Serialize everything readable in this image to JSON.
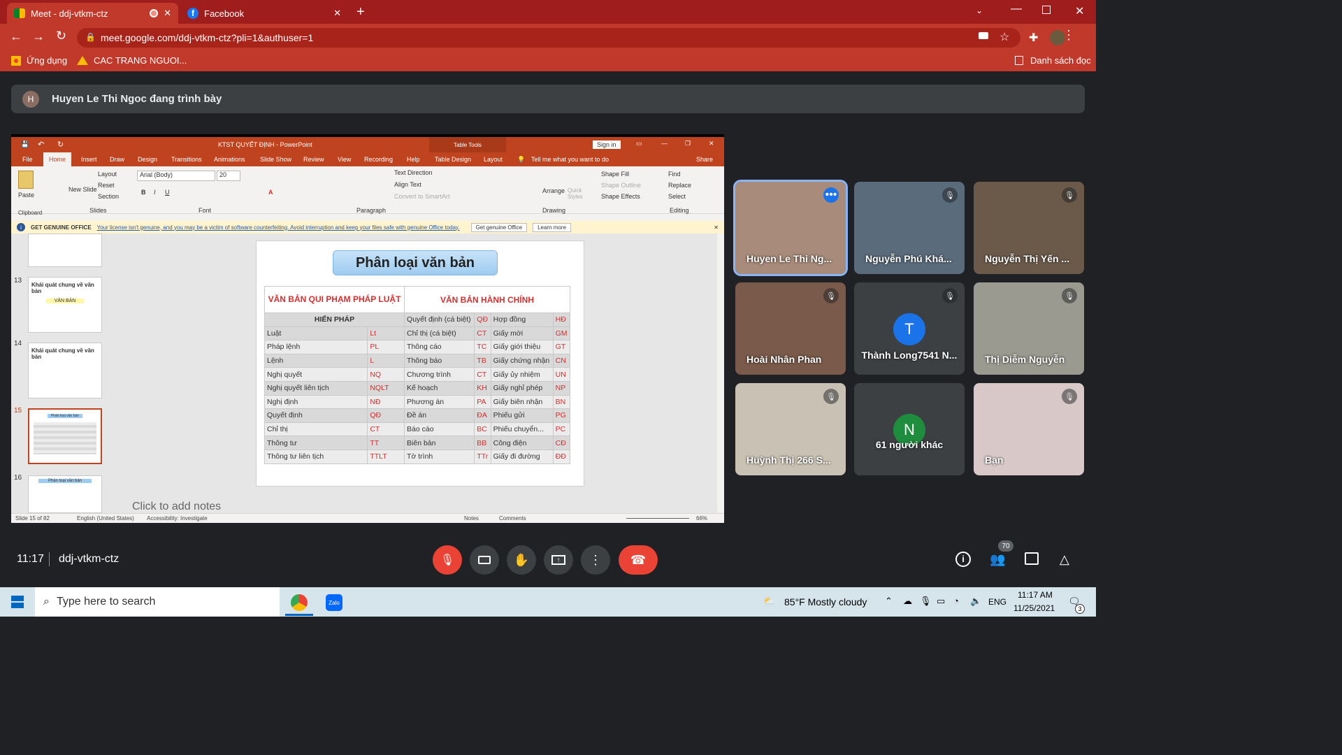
{
  "browser": {
    "tabs": [
      {
        "label": "Meet - ddj-vtkm-ctz",
        "active": true
      },
      {
        "label": "Facebook",
        "active": false
      }
    ],
    "url": "meet.google.com/ddj-vtkm-ctz?pli=1&authuser=1",
    "bookmarks": [
      "Ứng dụng",
      "CAC TRANG NGUOI..."
    ],
    "reading_list": "Danh sách đọc"
  },
  "banner": {
    "avatar_letter": "H",
    "text": "Huyen Le Thi Ngoc đang trình bày"
  },
  "ppt": {
    "window_title": "KTST QUYẾT ĐỊNH  -  PowerPoint",
    "table_tools": "Table Tools",
    "sign_in": "Sign in",
    "menu": [
      "File",
      "Home",
      "Insert",
      "Draw",
      "Design",
      "Transitions",
      "Animations",
      "Slide Show",
      "Review",
      "View",
      "Recording",
      "Help",
      "Table Design",
      "Layout"
    ],
    "tell_me": "Tell me what you want to do",
    "share": "Share",
    "ribbon": {
      "paste": "Paste",
      "clipboard": "Clipboard",
      "new_slide": "New Slide",
      "layout": "Layout",
      "reset": "Reset",
      "section": "Section",
      "slides": "Slides",
      "font_name": "Arial (Body)",
      "font_size": "20",
      "font": "Font",
      "paragraph": "Paragraph",
      "text_direction": "Text Direction",
      "align_text": "Align Text",
      "smartart": "Convert to SmartArt",
      "arrange": "Arrange",
      "quick_styles": "Quick Styles",
      "shape_fill": "Shape Fill",
      "shape_outline": "Shape Outline",
      "shape_effects": "Shape Effects",
      "drawing": "Drawing",
      "find": "Find",
      "replace": "Replace",
      "select": "Select",
      "editing": "Editing"
    },
    "genuine": {
      "label": "GET GENUINE OFFICE",
      "msg": "Your license isn't genuine, and you may be a victim of software counterfeiting. Avoid interruption and keep your files safe with genuine Office today.",
      "btn1": "Get genuine Office",
      "btn2": "Learn more"
    },
    "thumbs": [
      {
        "num": "13",
        "title": "Khái quát chung về văn bản",
        "sub": "VĂN BẢN"
      },
      {
        "num": "14",
        "title": "Khái quát chung về văn bản",
        "sub": ""
      },
      {
        "num": "15",
        "title": "Phân loại văn bản",
        "sub": ""
      },
      {
        "num": "16",
        "title": "Phân loại văn bản",
        "sub": ""
      }
    ],
    "slide": {
      "title": "Phân loại văn bản",
      "left_header": "VĂN BẢN QUI PHẠM PHÁP LUẬT",
      "right_header": "VĂN BẢN HÀNH CHÍNH",
      "first_row": "HIẾN PHÁP",
      "rows": [
        [
          "Quyết định (cá biệt)",
          "QĐ",
          "Hợp đồng",
          "HĐ"
        ],
        [
          "Luật",
          "Lt",
          "Chỉ thị (cá biệt)",
          "CT",
          "Giấy mời",
          "GM"
        ],
        [
          "Pháp lệnh",
          "PL",
          "Thông cáo",
          "TC",
          "Giấy giới thiệu",
          "GT"
        ],
        [
          "Lệnh",
          "L",
          "Thông báo",
          "TB",
          "Giấy chứng nhận",
          "CN"
        ],
        [
          "Nghị quyết",
          "NQ",
          "Chương trình",
          "CT",
          "Giấy ủy nhiệm",
          "UN"
        ],
        [
          "Nghị quyết liên tịch",
          "NQLT",
          "Kế hoạch",
          "KH",
          "Giấy nghỉ phép",
          "NP"
        ],
        [
          "Nghị định",
          "NĐ",
          "Phương án",
          "PA",
          "Giấy biên nhận",
          "BN"
        ],
        [
          "Quyết định",
          "QĐ",
          "Đề án",
          "ĐA",
          "Phiếu gửi",
          "PG"
        ],
        [
          "Chỉ thị",
          "CT",
          "Báo cáo",
          "BC",
          "Phiếu chuyển...",
          "PC"
        ],
        [
          "Thông tư",
          "TT",
          "Biên bản",
          "BB",
          "Công điện",
          "CĐ"
        ],
        [
          "Thông tư liên tịch",
          "TTLT",
          "Tờ trình",
          "TTr",
          "Giấy đi đường",
          "ĐĐ"
        ]
      ]
    },
    "notes_placeholder": "Click to add notes",
    "status": {
      "slide": "Slide 15 of 82",
      "lang": "English (United States)",
      "access": "Accessibility: Investigate",
      "notes": "Notes",
      "comments": "Comments",
      "zoom": "66%"
    }
  },
  "participants": [
    {
      "name": "Huyen Le Thi Ng...",
      "muted": false,
      "speaking": true,
      "bg": "#a88b7a"
    },
    {
      "name": "Nguyễn Phú Khá...",
      "muted": true,
      "bg": "#5a6b7c"
    },
    {
      "name": "Nguyễn Thị Yến ...",
      "muted": true,
      "bg": "#6b5a4a"
    },
    {
      "name": "Hoài Nhân Phan",
      "muted": true,
      "bg": "#7a5a4a"
    },
    {
      "name": "Thành Long7541 N...",
      "muted": true,
      "letter": "T",
      "bg": "#3c4043"
    },
    {
      "name": "Thị Diễm Nguyễn",
      "muted": true,
      "bg": "#9a9a90"
    },
    {
      "name": "Huỳnh Thị 266 S...",
      "muted": true,
      "bg": "#c9c2b4"
    },
    {
      "name": "61 người khác",
      "muted": false,
      "letter": "N",
      "bg": "#3c4043"
    },
    {
      "name": "Bạn",
      "muted": true,
      "bg": "#d8c8c8"
    }
  ],
  "meet_bar": {
    "time": "11:17",
    "code": "ddj-vtkm-ctz",
    "people_count": "70"
  },
  "taskbar": {
    "search": "Type here to search",
    "weather": "85°F  Mostly cloudy",
    "lang": "ENG",
    "time": "11:17 AM",
    "date": "11/25/2021",
    "notif": "3"
  }
}
